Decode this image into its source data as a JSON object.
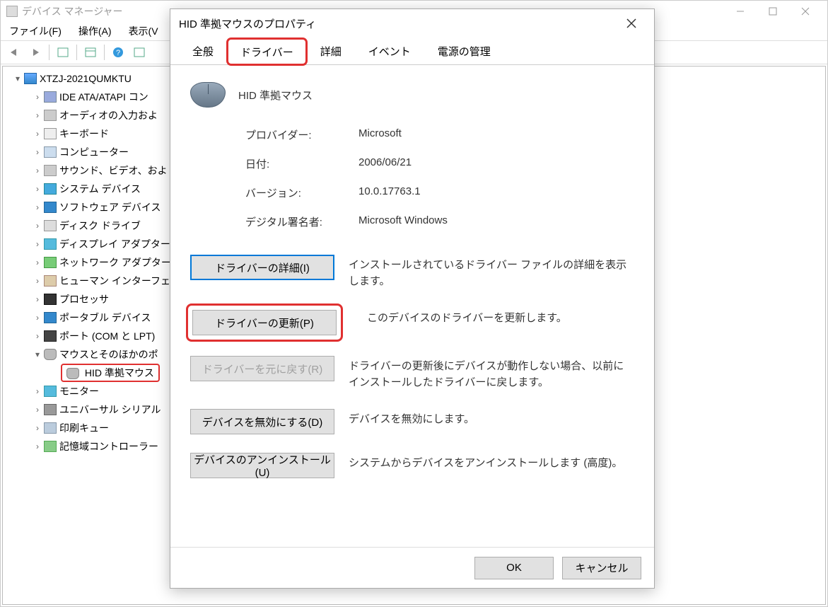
{
  "main_window": {
    "title": "デバイス マネージャー",
    "menu": {
      "file": "ファイル(F)",
      "action": "操作(A)",
      "view": "表示(V"
    }
  },
  "tree": {
    "root": "XTZJ-2021QUMKTU",
    "items": [
      {
        "label": "IDE ATA/ATAPI コン",
        "icon": "ic-ide"
      },
      {
        "label": "オーディオの入力およ",
        "icon": "ic-audio"
      },
      {
        "label": "キーボード",
        "icon": "ic-kbd"
      },
      {
        "label": "コンピューター",
        "icon": "ic-comp"
      },
      {
        "label": "サウンド、ビデオ、およ",
        "icon": "ic-sound"
      },
      {
        "label": "システム デバイス",
        "icon": "ic-sys"
      },
      {
        "label": "ソフトウェア デバイス",
        "icon": "ic-soft"
      },
      {
        "label": "ディスク ドライブ",
        "icon": "ic-disk"
      },
      {
        "label": "ディスプレイ アダプター",
        "icon": "ic-display"
      },
      {
        "label": "ネットワーク アダプター",
        "icon": "ic-net"
      },
      {
        "label": "ヒューマン インターフェ",
        "icon": "ic-hid"
      },
      {
        "label": "プロセッサ",
        "icon": "ic-cpu"
      },
      {
        "label": "ポータブル デバイス",
        "icon": "ic-portable"
      },
      {
        "label": "ポート (COM と LPT)",
        "icon": "ic-port"
      }
    ],
    "mouse_category": "マウスとそのほかのポ",
    "mouse_item": "HID 準拠マウス",
    "after_items": [
      {
        "label": "モニター",
        "icon": "ic-monitor"
      },
      {
        "label": "ユニバーサル シリアル",
        "icon": "ic-usb"
      },
      {
        "label": "印刷キュー",
        "icon": "ic-print"
      },
      {
        "label": "記憶域コントローラー",
        "icon": "ic-storage"
      }
    ]
  },
  "dialog": {
    "title": "HID 準拠マウスのプロパティ",
    "tabs": {
      "general": "全般",
      "driver": "ドライバー",
      "details": "詳細",
      "events": "イベント",
      "power": "電源の管理"
    },
    "device_name": "HID 準拠マウス",
    "props": {
      "provider_k": "プロバイダー:",
      "provider_v": "Microsoft",
      "date_k": "日付:",
      "date_v": "2006/06/21",
      "version_k": "バージョン:",
      "version_v": "10.0.17763.1",
      "signer_k": "デジタル署名者:",
      "signer_v": "Microsoft Windows"
    },
    "actions": {
      "details_btn": "ドライバーの詳細(I)",
      "details_desc": "インストールされているドライバー ファイルの詳細を表示します。",
      "update_btn": "ドライバーの更新(P)",
      "update_desc": "このデバイスのドライバーを更新します。",
      "rollback_btn": "ドライバーを元に戻す(R)",
      "rollback_desc": "ドライバーの更新後にデバイスが動作しない場合、以前にインストールしたドライバーに戻します。",
      "disable_btn": "デバイスを無効にする(D)",
      "disable_desc": "デバイスを無効にします。",
      "uninstall_btn": "デバイスのアンインストール(U)",
      "uninstall_desc": "システムからデバイスをアンインストールします (高度)。"
    },
    "footer": {
      "ok": "OK",
      "cancel": "キャンセル"
    }
  }
}
